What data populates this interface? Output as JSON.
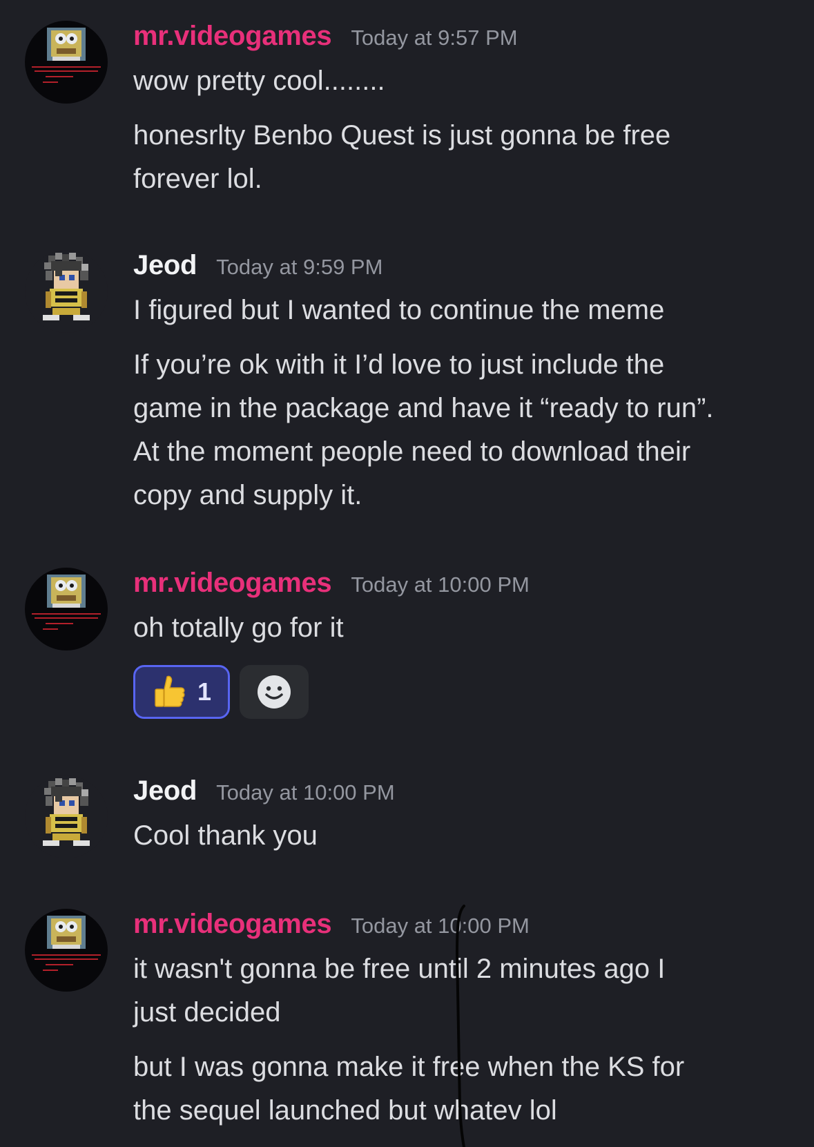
{
  "colors": {
    "background": "#1e1f25",
    "username_pink": "#e8307a",
    "username_white": "#f2f3f5",
    "timestamp": "#9497a0",
    "message_text": "#dcdde1",
    "reaction_active_bg": "#2c316e",
    "reaction_active_border": "#5865f2"
  },
  "messages": [
    {
      "author": "mr.videogames",
      "timestamp": "Today at 9:57 PM",
      "avatar_icon": "spongebob-avatar-icon",
      "paragraphs": [
        [
          "wow pretty cool........"
        ],
        [
          "honesrlty Benbo Quest is just gonna be free",
          "forever lol."
        ]
      ]
    },
    {
      "author": "Jeod",
      "timestamp": "Today at 9:59 PM",
      "avatar_icon": "pixel-character-avatar-icon",
      "paragraphs": [
        [
          "I figured but I wanted to continue the meme"
        ],
        [
          "If you’re ok with it I’d love to just include the",
          "game in the package and have it “ready to run”.",
          "At the moment people need to download their",
          "copy and supply it."
        ]
      ]
    },
    {
      "author": "mr.videogames",
      "timestamp": "Today at 10:00 PM",
      "avatar_icon": "spongebob-avatar-icon",
      "paragraphs": [
        [
          "oh totally go for it"
        ]
      ],
      "reactions": [
        {
          "emoji_icon": "thumbs-up-icon",
          "count": "1"
        }
      ]
    },
    {
      "author": "Jeod",
      "timestamp": "Today at 10:00 PM",
      "avatar_icon": "pixel-character-avatar-icon",
      "paragraphs": [
        [
          "Cool thank you"
        ]
      ]
    },
    {
      "author": "mr.videogames",
      "timestamp": "Today at 10:00 PM",
      "avatar_icon": "spongebob-avatar-icon",
      "paragraphs": [
        [
          "it wasn't gonna be free until 2 minutes ago I",
          "just decided"
        ],
        [
          "but I was gonna make it free when the KS for",
          "the sequel launched but whatev lol"
        ]
      ]
    }
  ]
}
